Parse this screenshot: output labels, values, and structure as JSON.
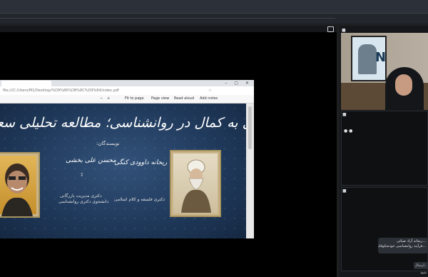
{
  "shared_screen": {
    "browser": {
      "address": "file:///C:/Users/M1/Desktop/%D9%86%DB%8C%D9%84/index.pdf",
      "toolbar_items": [
        "Fit to page",
        "Page view",
        "Read aloud",
        "Add notes"
      ],
      "window_controls": "– ▢ ✕"
    },
    "slide": {
      "title": "نیل به کمال در روانشناسی؛ مطالعه تحلیلی سعادت فارابی و خودشکوفایی مزلو",
      "authors_label": "نویسندگان:",
      "authors": [
        {
          "name": "ریحانه داوودی کنگی",
          "affiliation_1": "دکتری فلسفه و کلام اسلامی",
          "affiliation_2": ""
        },
        {
          "name": "محسن علی بخشی",
          "affiliation_1": "دکتری مدیریت بازرگانی",
          "affiliation_2": "دانشجوی دکتری روانشناسی"
        }
      ]
    }
  },
  "side_panel": {
    "panels": [
      {
        "header": "■"
      },
      {
        "header": "■"
      },
      {
        "header": "■"
      }
    ],
    "dots": "● ●",
    "chat_message_1": "...ریحانه آزاد ضیائی",
    "chat_message_2": "...فرآیند روانشناسی خودشکوفایی",
    "chat_input": "..ارسال شود"
  },
  "colors": {
    "slide_bg": "#203a5c",
    "frame_gold": "#c9b48a",
    "app_bg": "#1e1f21"
  }
}
